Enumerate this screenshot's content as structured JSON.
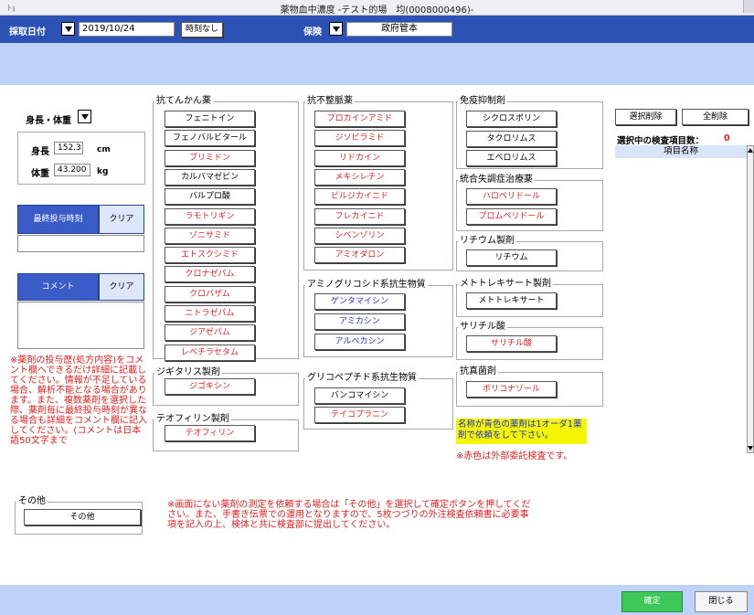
{
  "window": {
    "title": "薬物血中濃度 -テスト的場　均(0008000496)-"
  },
  "header": {
    "date_label": "採取日付",
    "date_value": "2019/10/24",
    "time_button": "時刻なし",
    "insurance_label": "保険",
    "insurance_value": "政府管本"
  },
  "body": {
    "height_weight_label": "身長・体重",
    "height_label": "身長",
    "height_value": "152.3",
    "height_unit": "cm",
    "weight_label": "体重",
    "weight_value": "43.200",
    "weight_unit": "kg",
    "last_dose_button": "最終投与時刻",
    "last_dose_clear": "クリア",
    "last_dose_value": "",
    "comment_button": "コメント",
    "comment_clear": "クリア",
    "comment_value": "",
    "left_note": "※薬剤の投与歴(処方内容)をコメント欄へできるだけ詳細に記載してください。情報が不足している場合、解析不能となる場合があります。また、複数薬剤を選択した際、薬剤毎に最終投与時刻が異なる場合も詳細をコメント欄に記入してください。(コメントは日本語50文字まで"
  },
  "groups": {
    "antiepileptic": {
      "title": "抗てんかん薬",
      "items": [
        {
          "label": "フェニトイン",
          "color": "black"
        },
        {
          "label": "フェノバルビタール",
          "color": "black"
        },
        {
          "label": "プリミドン",
          "color": "red"
        },
        {
          "label": "カルバマゼピン",
          "color": "black"
        },
        {
          "label": "バルプロ酸",
          "color": "black"
        },
        {
          "label": "ラモトリギン",
          "color": "red"
        },
        {
          "label": "ゾニサミド",
          "color": "red"
        },
        {
          "label": "エトスクシミド",
          "color": "red"
        },
        {
          "label": "クロナゼパム",
          "color": "red"
        },
        {
          "label": "クロバザム",
          "color": "red"
        },
        {
          "label": "ニトラゼパム",
          "color": "red"
        },
        {
          "label": "ジアゼパム",
          "color": "red"
        },
        {
          "label": "レベチラセタム",
          "color": "red"
        }
      ]
    },
    "digitalis": {
      "title": "ジギタリス製剤",
      "items": [
        {
          "label": "ジゴキシン",
          "color": "red"
        }
      ]
    },
    "theophylline": {
      "title": "テオフィリン製剤",
      "items": [
        {
          "label": "テオフィリン",
          "color": "red"
        }
      ]
    },
    "antiarrhythmic": {
      "title": "抗不整脈薬",
      "items": [
        {
          "label": "プロカインアミド",
          "color": "red"
        },
        {
          "label": "ジソピラミド",
          "color": "red"
        },
        {
          "label": "リドカイン",
          "color": "red"
        },
        {
          "label": "メキシレチン",
          "color": "red"
        },
        {
          "label": "ピルジカイニド",
          "color": "red"
        },
        {
          "label": "フレカイニド",
          "color": "red"
        },
        {
          "label": "シベンゾリン",
          "color": "red"
        },
        {
          "label": "アミオダロン",
          "color": "red"
        }
      ]
    },
    "aminoglycoside": {
      "title": "アミノグリコシド系抗生物質",
      "items": [
        {
          "label": "ゲンタマイシン",
          "color": "blue"
        },
        {
          "label": "アミカシン",
          "color": "blue"
        },
        {
          "label": "アルベカシン",
          "color": "blue"
        }
      ]
    },
    "glycopeptide": {
      "title": "グリコペプチド系抗生物質",
      "items": [
        {
          "label": "バンコマイシン",
          "color": "black"
        },
        {
          "label": "テイコプラニン",
          "color": "red"
        }
      ]
    },
    "immunosuppressant": {
      "title": "免疫抑制剤",
      "items": [
        {
          "label": "シクロスポリン",
          "color": "black"
        },
        {
          "label": "タクロリムス",
          "color": "black"
        },
        {
          "label": "エベロリムス",
          "color": "black"
        }
      ]
    },
    "antipsychotic": {
      "title": "統合失調症治療薬",
      "items": [
        {
          "label": "ハロペリドール",
          "color": "red"
        },
        {
          "label": "ブロムペリドール",
          "color": "red"
        }
      ]
    },
    "lithium": {
      "title": "リチウム製剤",
      "items": [
        {
          "label": "リチウム",
          "color": "black"
        }
      ]
    },
    "methotrexate": {
      "title": "メトトレキサート製剤",
      "items": [
        {
          "label": "メトトレキサート",
          "color": "black"
        }
      ]
    },
    "salicylic": {
      "title": "サリチル酸",
      "items": [
        {
          "label": "サリチル酸",
          "color": "red"
        }
      ]
    },
    "antifungal": {
      "title": "抗真菌剤",
      "items": [
        {
          "label": "ボリコナゾール",
          "color": "red"
        }
      ]
    },
    "other": {
      "title": "その他",
      "items": [
        {
          "label": "その他",
          "color": "black"
        }
      ]
    }
  },
  "notes": {
    "blue_note": "名称が青色の薬剤は1オーダ1薬剤で依頼をして下さい。",
    "red_note": "※赤色は外部委託検査です。",
    "other_note": "※画面にない薬剤の測定を依頼する場合は「その他」を選択して確定ボタンを押してください。また、手書き伝票での運用となりますので、5枚つづりの外注検査依頼書に必要事項を記入の上、検体と共に検査部に提出してください。"
  },
  "right_panel": {
    "delete_selected": "選択削除",
    "delete_all": "全削除",
    "selected_count_label": "選択中の検査項目数：",
    "selected_count": "0",
    "column_header": "項目名称"
  },
  "footer": {
    "confirm": "確定",
    "close": "閉じる"
  },
  "colors": {
    "header_blue": "#2c52b6",
    "sub_header": "#bed2f7",
    "button_blue": "#3a5cc8",
    "red_text": "#e02020",
    "blue_text": "#1a2fd8",
    "highlight_yellow": "#f5f500",
    "confirm_green": "#3ec85a",
    "column_header_bg": "#d8e4f8"
  }
}
